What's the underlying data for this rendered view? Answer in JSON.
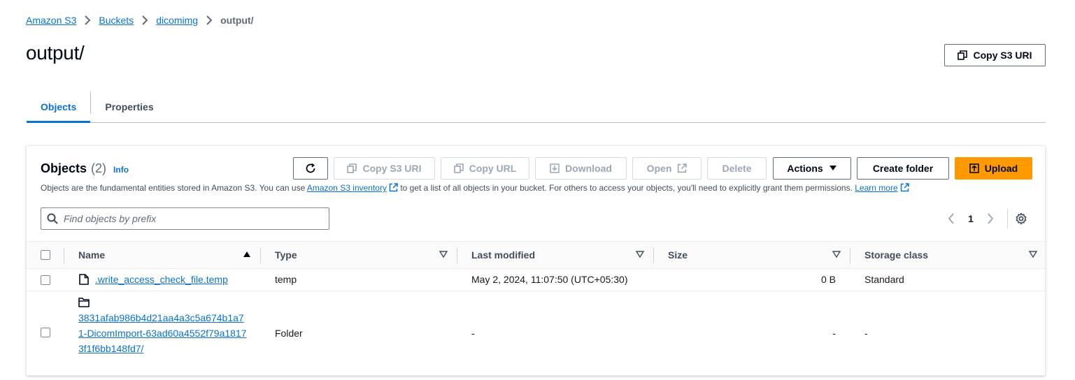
{
  "breadcrumb": {
    "items": [
      "Amazon S3",
      "Buckets",
      "dicomimg"
    ],
    "current": "output/"
  },
  "page": {
    "title": "output/",
    "copy_s3_uri": "Copy S3 URI"
  },
  "tabs": [
    {
      "label": "Objects",
      "active": true
    },
    {
      "label": "Properties",
      "active": false
    }
  ],
  "objects_panel": {
    "title": "Objects",
    "count": "(2)",
    "info": "Info",
    "desc_pre": "Objects are the fundamental entities stored in Amazon S3. You can use ",
    "desc_link1": "Amazon S3 inventory",
    "desc_mid": " to get a list of all objects in your bucket. For others to access your objects, you'll need to explicitly grant them permissions. ",
    "desc_link2": "Learn more"
  },
  "toolbar": {
    "refresh": "refresh-icon",
    "copy_s3_uri": "Copy S3 URI",
    "copy_url": "Copy URL",
    "download": "Download",
    "open": "Open",
    "delete": "Delete",
    "actions": "Actions",
    "create_folder": "Create folder",
    "upload": "Upload",
    "upload_color": "#ff9900"
  },
  "search": {
    "placeholder": "Find objects by prefix",
    "value": ""
  },
  "pagination": {
    "page": "1"
  },
  "table": {
    "columns": [
      "Name",
      "Type",
      "Last modified",
      "Size",
      "Storage class"
    ],
    "rows": [
      {
        "icon": "file-icon",
        "name": ".write_access_check_file.temp",
        "type": "temp",
        "last_modified": "May 2, 2024, 11:07:50 (UTC+05:30)",
        "size": "0 B",
        "storage_class": "Standard"
      },
      {
        "icon": "folder-icon",
        "name": "3831afab986b4d21aa4a3c5a674b1a71-DicomImport-63ad60a4552f79a18173f1f6bb148fd7/",
        "type": "Folder",
        "last_modified": "-",
        "size": "-",
        "storage_class": "-"
      }
    ]
  }
}
